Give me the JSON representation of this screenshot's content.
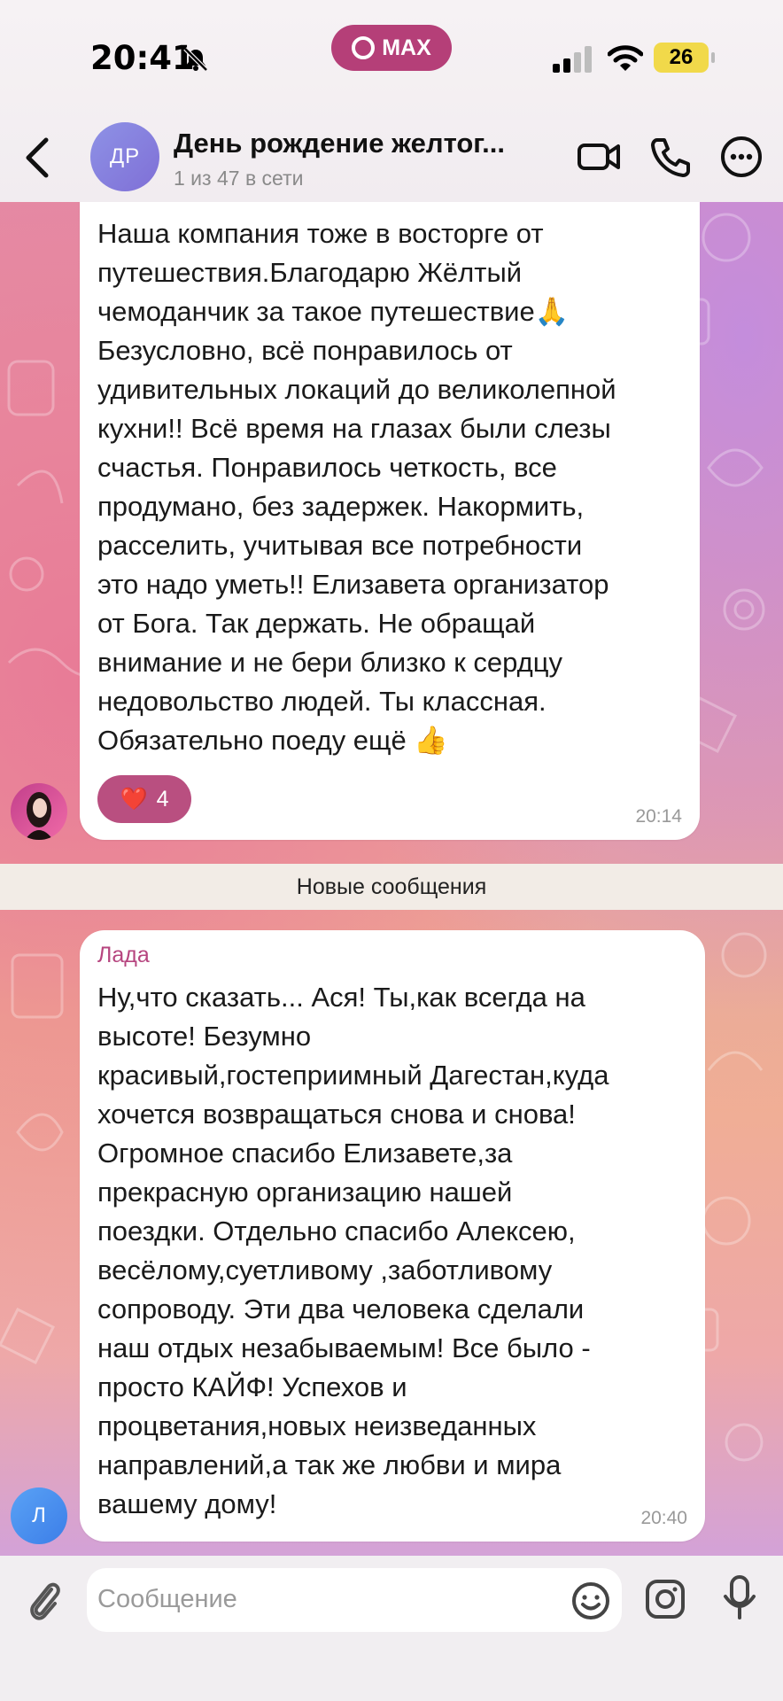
{
  "status_bar": {
    "time": "20:41",
    "app_pill": "MAX",
    "battery": "26"
  },
  "header": {
    "avatar_initials": "ДР",
    "title": "День рождение желтог...",
    "subtitle": "1 из 47 в сети"
  },
  "messages": [
    {
      "text": "Наша компания тоже в восторге от\nпутешествия.Благодарю Жёлтый\nчемоданчик за такое путешествие🙏\nБезусловно, всё понравилось от\nудивительных локаций до великолепной\nкухни!! Всё время на глазах  были слезы\nсчастья. Понравилось четкость, все\nпродумано, без задержек. Накормить,\nрасселить, учитывая все потребности\nэто надо уметь!! Елизавета организатор\nот Бога. Так держать. Не обращай\nвнимание и не бери близко к сердцу\nнедовольство людей. Ты классная.\nОбязательно поеду ещё 👍",
      "reaction_emoji": "❤️",
      "reaction_count": "4",
      "time": "20:14"
    },
    {
      "sender": "Лада",
      "sender_avatar": "Л",
      "text": "Ну,что сказать... Ася! Ты,как всегда на\nвысоте! Безумно\nкрасивый,гостеприимный Дагестан,куда\nхочется возвращаться снова и снова!\nОгромное спасибо Елизавете,за\nпрекрасную организацию нашей\nпоездки. Отдельно спасибо Алексею,\nвесёлому,суетливому ,заботливому\nсопроводу. Эти два человека сделали\nнаш отдых незабываемым! Все было -\nпросто КАЙФ! Успехов и\nпроцветания,новых неизведанных\nнаправлений,а так же любви и мира\nвашему дому!",
      "time": "20:40"
    }
  ],
  "divider": "Новые сообщения",
  "composer": {
    "placeholder": "Сообщение"
  },
  "colors": {
    "accent": "#b53f78",
    "sender": "#b6457f",
    "reaction": "#b94f80"
  }
}
